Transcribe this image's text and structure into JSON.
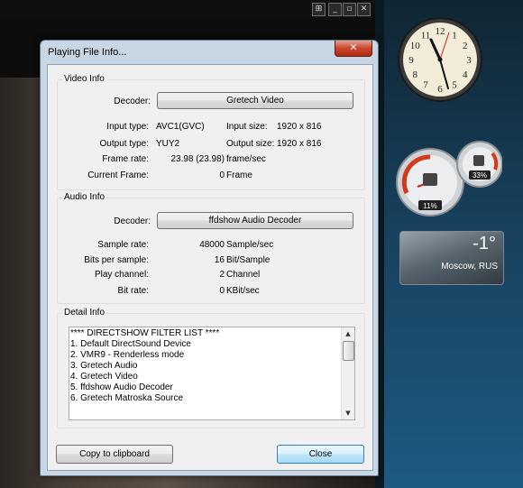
{
  "player": {
    "buttons": [
      "⊞",
      "_",
      "▫",
      "✕"
    ]
  },
  "dialog": {
    "title": "Playing File Info...",
    "close_glyph": "✕",
    "video": {
      "heading": "Video Info",
      "decoder_label": "Decoder:",
      "decoder_value": "Gretech Video",
      "input_type_label": "Input type:",
      "input_type_value": "AVC1(GVC)",
      "input_size_label": "Input size:",
      "input_size_value": "1920 x 816",
      "output_type_label": "Output type:",
      "output_type_value": "YUY2",
      "output_size_label": "Output size:",
      "output_size_value": "1920 x 816",
      "frame_rate_label": "Frame rate:",
      "frame_rate_value": "23.98 (23.98)",
      "frame_rate_unit": "frame/sec",
      "current_frame_label": "Current Frame:",
      "current_frame_value": "0",
      "current_frame_unit": "Frame"
    },
    "audio": {
      "heading": "Audio Info",
      "decoder_label": "Decoder:",
      "decoder_value": "ffdshow Audio Decoder",
      "sample_rate_label": "Sample rate:",
      "sample_rate_value": "48000",
      "sample_rate_unit": "Sample/sec",
      "bits_label": "Bits per sample:",
      "bits_value": "16",
      "bits_unit": "Bit/Sample",
      "channel_label": "Play channel:",
      "channel_value": "2",
      "channel_unit": "Channel",
      "bitrate_label": "Bit rate:",
      "bitrate_value": "0",
      "bitrate_unit": "KBit/sec"
    },
    "detail": {
      "heading": "Detail Info",
      "lines": [
        "**** DIRECTSHOW FILTER LIST ****",
        "1. Default DirectSound Device",
        "2. VMR9 - Renderless mode",
        "3. Gretech Audio",
        "4. Gretech Video",
        "5. ffdshow Audio Decoder",
        "6. Gretech Matroska Source"
      ]
    },
    "copy_button": "Copy to clipboard",
    "close_button": "Close"
  },
  "gadgets": {
    "clock_numbers": [
      "12",
      "1",
      "2",
      "3",
      "4",
      "5",
      "6",
      "7",
      "8",
      "9",
      "10",
      "11"
    ],
    "cpu_percent": "11%",
    "memory_percent": "33%",
    "weather_temp": "-1°",
    "weather_city": "Moscow, RUS"
  },
  "colors": {
    "dialog_frame": "#c9d6e3",
    "close_red": "#c8452b",
    "default_button": "#a7d9f5"
  }
}
